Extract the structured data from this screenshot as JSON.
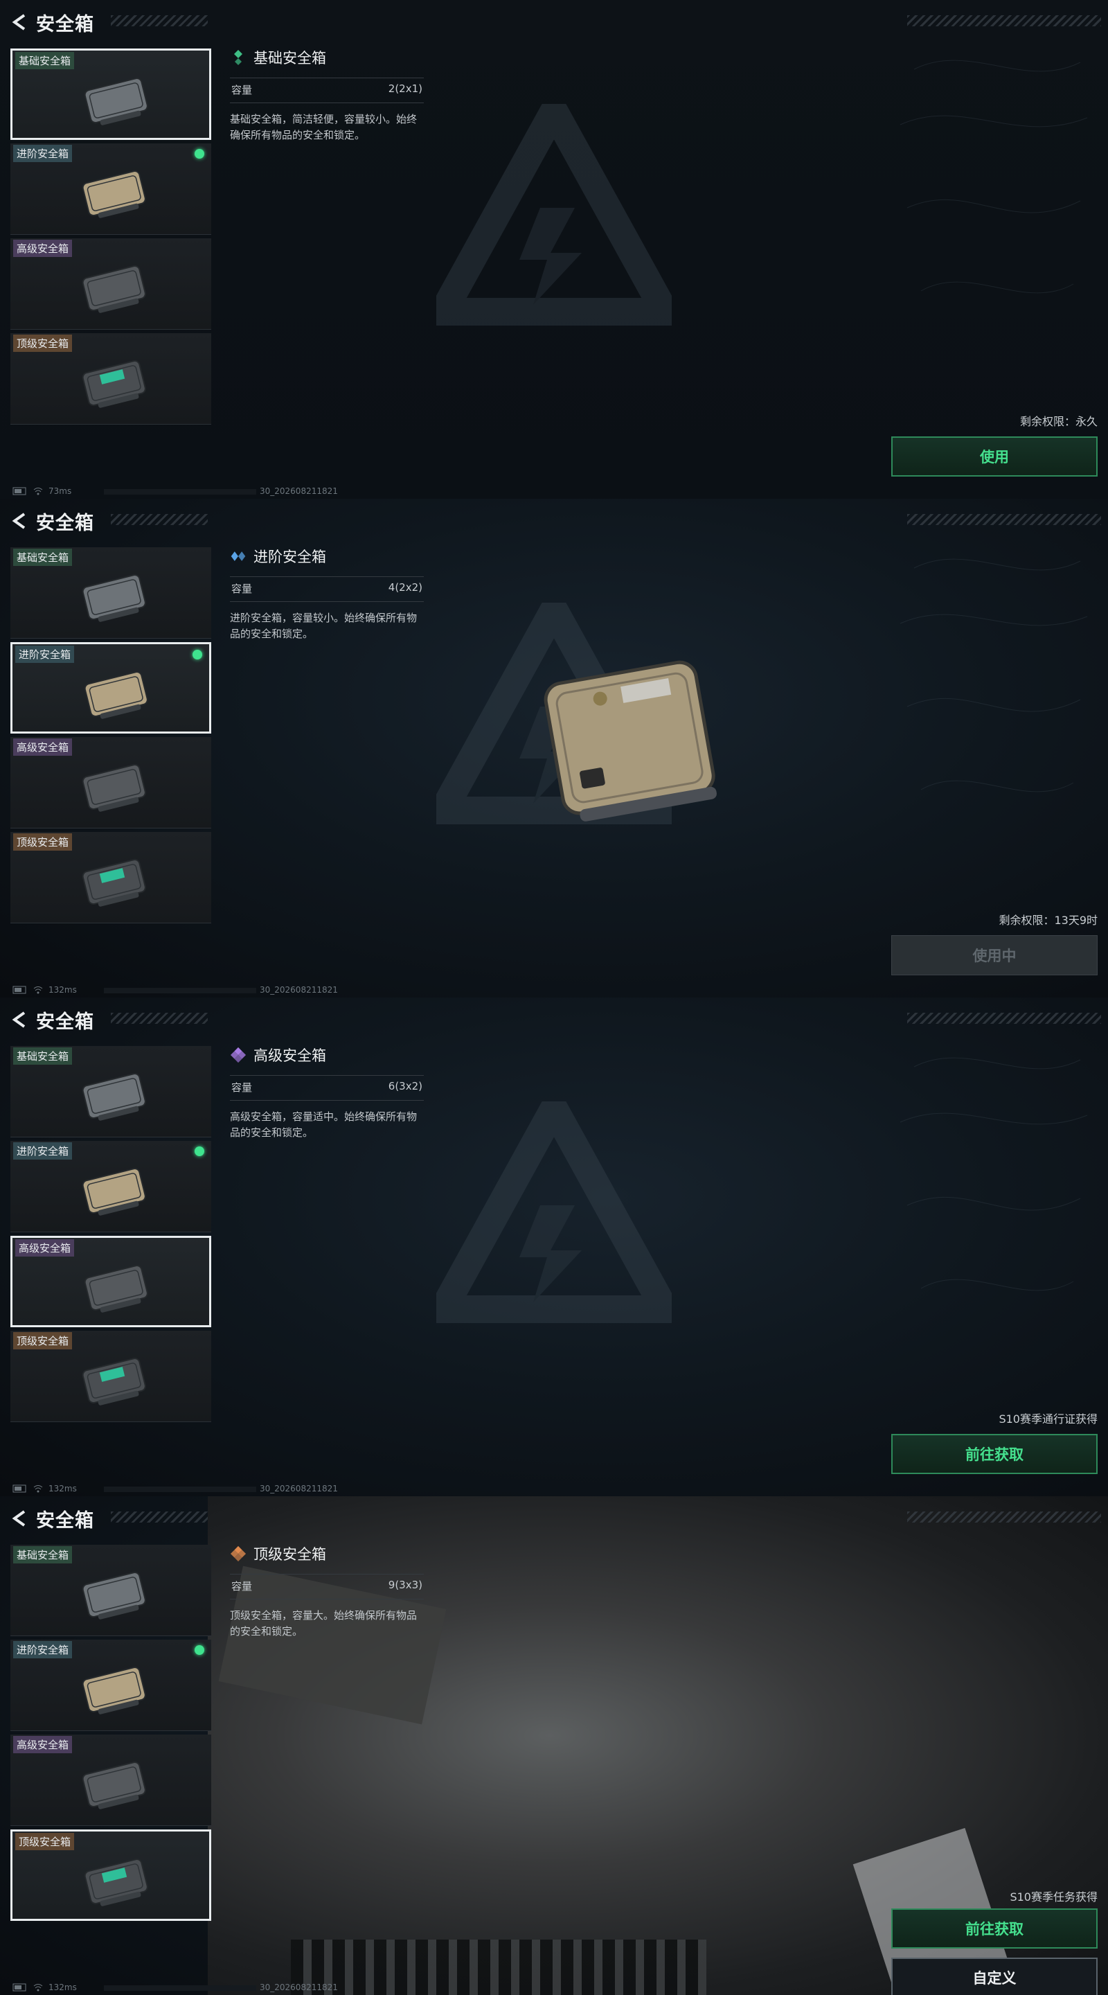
{
  "screens": [
    {
      "header_title": "安全箱",
      "list": [
        {
          "label": "基础安全箱",
          "tier": "basic",
          "selected": true,
          "equipped": false
        },
        {
          "label": "进阶安全箱",
          "tier": "adv",
          "selected": false,
          "equipped": true
        },
        {
          "label": "高级安全箱",
          "tier": "high",
          "selected": false,
          "equipped": false
        },
        {
          "label": "顶级安全箱",
          "tier": "top",
          "selected": false,
          "equipped": false
        }
      ],
      "info": {
        "name": "基础安全箱",
        "cap_label": "容量",
        "cap_value": "2(2x1)",
        "desc": "基础安全箱，简洁轻便，容量较小。始终确保所有物品的安全和锁定。"
      },
      "perm": "剩余权限：永久",
      "buttons": [
        {
          "label": "使用",
          "style": "green"
        }
      ],
      "ping": "73ms",
      "build": "30_202608211821"
    },
    {
      "header_title": "安全箱",
      "list": [
        {
          "label": "基础安全箱",
          "tier": "basic",
          "selected": false,
          "equipped": false
        },
        {
          "label": "进阶安全箱",
          "tier": "adv",
          "selected": true,
          "equipped": true
        },
        {
          "label": "高级安全箱",
          "tier": "high",
          "selected": false,
          "equipped": false
        },
        {
          "label": "顶级安全箱",
          "tier": "top",
          "selected": false,
          "equipped": false
        }
      ],
      "info": {
        "name": "进阶安全箱",
        "cap_label": "容量",
        "cap_value": "4(2x2)",
        "desc": "进阶安全箱，容量较小。始终确保所有物品的安全和锁定。"
      },
      "perm": "剩余权限：13天9时",
      "buttons": [
        {
          "label": "使用中",
          "style": "dim"
        }
      ],
      "ping": "132ms",
      "build": "30_202608211821"
    },
    {
      "header_title": "安全箱",
      "list": [
        {
          "label": "基础安全箱",
          "tier": "basic",
          "selected": false,
          "equipped": false
        },
        {
          "label": "进阶安全箱",
          "tier": "adv",
          "selected": false,
          "equipped": true
        },
        {
          "label": "高级安全箱",
          "tier": "high",
          "selected": true,
          "equipped": false
        },
        {
          "label": "顶级安全箱",
          "tier": "top",
          "selected": false,
          "equipped": false
        }
      ],
      "info": {
        "name": "高级安全箱",
        "cap_label": "容量",
        "cap_value": "6(3x2)",
        "desc": "高级安全箱，容量适中。始终确保所有物品的安全和锁定。"
      },
      "perm": "S10赛季通行证获得",
      "buttons": [
        {
          "label": "前往获取",
          "style": "green"
        }
      ],
      "ping": "132ms",
      "build": "30_202608211821"
    },
    {
      "header_title": "安全箱",
      "list": [
        {
          "label": "基础安全箱",
          "tier": "basic",
          "selected": false,
          "equipped": false
        },
        {
          "label": "进阶安全箱",
          "tier": "adv",
          "selected": false,
          "equipped": true
        },
        {
          "label": "高级安全箱",
          "tier": "high",
          "selected": false,
          "equipped": false
        },
        {
          "label": "顶级安全箱",
          "tier": "top",
          "selected": true,
          "equipped": false
        }
      ],
      "info": {
        "name": "顶级安全箱",
        "cap_label": "容量",
        "cap_value": "9(3x3)",
        "desc": "顶级安全箱，容量大。始终确保所有物品的安全和锁定。"
      },
      "perm": "S10赛季任务获得",
      "buttons": [
        {
          "label": "前往获取",
          "style": "green"
        },
        {
          "label": "自定义",
          "style": "white"
        }
      ],
      "ping": "132ms",
      "build": "30_202608211821"
    }
  ],
  "colors": {
    "accent_green": "#45e08e",
    "equipped_dot": "#3fe38e",
    "tier_basic": "#3fbf86",
    "tier_adv": "#5aa3e6",
    "tier_high": "#a77be3",
    "tier_top": "#e08a4e"
  },
  "icons": {
    "back": "chevron-left-icon",
    "equipped": "status-dot-icon",
    "quality": "diamond-quality-icon"
  }
}
